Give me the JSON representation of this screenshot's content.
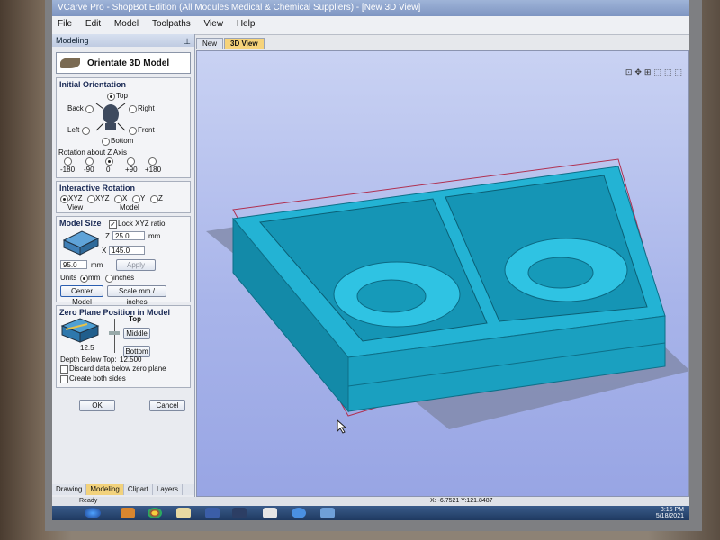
{
  "window": {
    "title": "VCarve Pro - ShopBot Edition (All Modules Medical & Chemical Suppliers) - [New 3D View]"
  },
  "menu": [
    "File",
    "Edit",
    "Model",
    "Toolpaths",
    "View",
    "Help"
  ],
  "panel": {
    "title": "Modeling",
    "orientate_label": "Orientate 3D Model",
    "initial_orientation": {
      "heading": "Initial Orientation",
      "top": "Top",
      "back": "Back",
      "right": "Right",
      "left": "Left",
      "front": "Front",
      "bottom": "Bottom",
      "rotation_label": "Rotation about Z Axis",
      "rotations": [
        "-180",
        "-90",
        "0",
        "+90",
        "+180"
      ]
    },
    "interactive_rotation": {
      "heading": "Interactive Rotation",
      "options": [
        "XYZ",
        "XYZ",
        "X",
        "Y",
        "Z"
      ],
      "view": "View",
      "model": "Model"
    },
    "model_size": {
      "heading": "Model Size",
      "lock": "Lock XYZ ratio",
      "z_label": "Z",
      "z_value": "25.0",
      "z_unit": "mm",
      "x_label": "X",
      "x_value": "145.0",
      "y_value": "95.0",
      "y_unit": "mm",
      "apply": "Apply",
      "units_label": "Units",
      "mm": "mm",
      "inches": "inches",
      "center": "Center Model",
      "scale": "Scale mm / inches"
    },
    "zero_plane": {
      "heading": "Zero Plane Position in Model",
      "top": "Top",
      "middle": "Middle",
      "bottom": "Bottom",
      "depth_value": "12.5",
      "depth_label": "Depth Below Top:",
      "depth_reading": "12.500",
      "discard": "Discard data below zero plane",
      "both": "Create both sides"
    },
    "ok": "OK",
    "cancel": "Cancel",
    "tabs": [
      "Drawing",
      "Modeling",
      "Clipart",
      "Layers"
    ]
  },
  "doctabs": [
    "New",
    "3D View"
  ],
  "status": {
    "left": "Ready",
    "coords": "X: -6.7521 Y:121.8487"
  },
  "clock": {
    "time": "3:15 PM",
    "date": "5/18/2021"
  },
  "colors": {
    "model": "#1aa7c7",
    "model_dark": "#0f7e9a",
    "view_bg": "#a9b5ea",
    "active_tab": "#f2d27c"
  }
}
